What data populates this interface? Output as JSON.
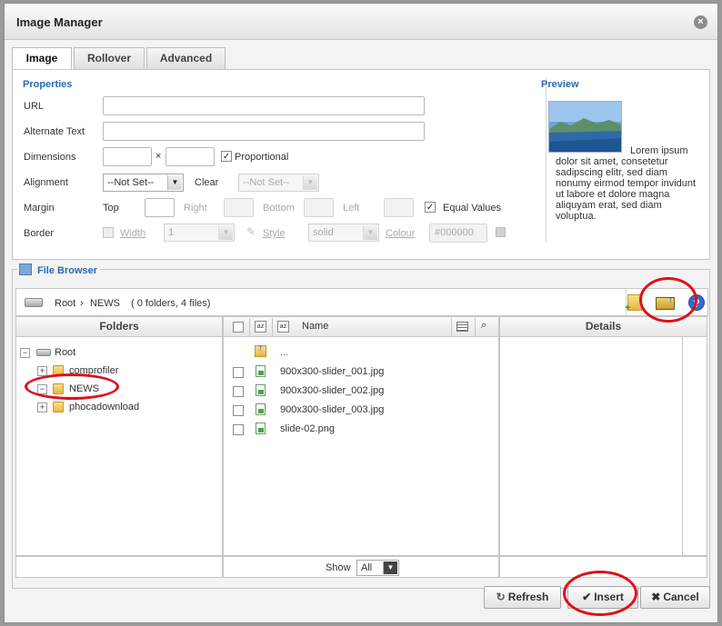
{
  "dialog": {
    "title": "Image Manager",
    "close_glyph": "×"
  },
  "tabs": [
    {
      "label": "Image",
      "active": true
    },
    {
      "label": "Rollover",
      "active": false
    },
    {
      "label": "Advanced",
      "active": false
    }
  ],
  "properties": {
    "heading": "Properties",
    "url_label": "URL",
    "url_value": "",
    "alt_label": "Alternate Text",
    "alt_value": "",
    "dimensions_label": "Dimensions",
    "dimensions_sep": "×",
    "width_value": "",
    "height_value": "",
    "proportional_label": "Proportional",
    "proportional_checked": true,
    "alignment_label": "Alignment",
    "alignment_value": "--Not Set--",
    "clear_label": "Clear",
    "clear_value": "--Not Set--",
    "margin_label": "Margin",
    "margin_top": "Top",
    "margin_right": "Right",
    "margin_bottom": "Bottom",
    "margin_left": "Left",
    "equal_values_label": "Equal Values",
    "equal_values_checked": true,
    "border_label": "Border",
    "border_width_label": "Width",
    "border_width_value": "1",
    "border_style_label": "Style",
    "border_style_value": "solid",
    "border_colour_label": "Colour",
    "border_colour_value": "#000000"
  },
  "preview": {
    "heading": "Preview",
    "text": "Lorem ipsum dolor sit amet, consetetur sadipscing elitr, sed diam nonumy eirmod tempor invidunt ut labore et dolore magna aliquyam erat, sed diam voluptua."
  },
  "file_browser": {
    "legend": "File Browser",
    "path_root": "Root",
    "path_sep": "›",
    "path_current": "NEWS",
    "path_info": "( 0 folders, 4 files)",
    "folders_header": "Folders",
    "name_header": "Name",
    "details_header": "Details",
    "tree": {
      "root": "Root",
      "children": [
        {
          "label": "comprofiler",
          "expander": "+"
        },
        {
          "label": "NEWS",
          "expander": "−"
        },
        {
          "label": "phocadownload",
          "expander": "+"
        }
      ]
    },
    "files": [
      {
        "name": "...",
        "type": "up"
      },
      {
        "name": "900x300-slider_001.jpg",
        "type": "image"
      },
      {
        "name": "900x300-slider_002.jpg",
        "type": "image"
      },
      {
        "name": "900x300-slider_003.jpg",
        "type": "image"
      },
      {
        "name": "slide-02.png",
        "type": "image"
      }
    ],
    "show_label": "Show",
    "show_value": "All"
  },
  "buttons": {
    "refresh": "Refresh",
    "insert": "Insert",
    "cancel": "Cancel"
  },
  "icons": [
    "close-icon",
    "drive-icon",
    "new-folder-icon",
    "upload-icon",
    "help-icon",
    "folder-icon",
    "image-file-icon",
    "up-folder-icon",
    "refresh-icon",
    "check-icon",
    "cross-icon"
  ],
  "colors": {
    "accent": "#2a6ab5",
    "annotation": "#e0101a"
  }
}
